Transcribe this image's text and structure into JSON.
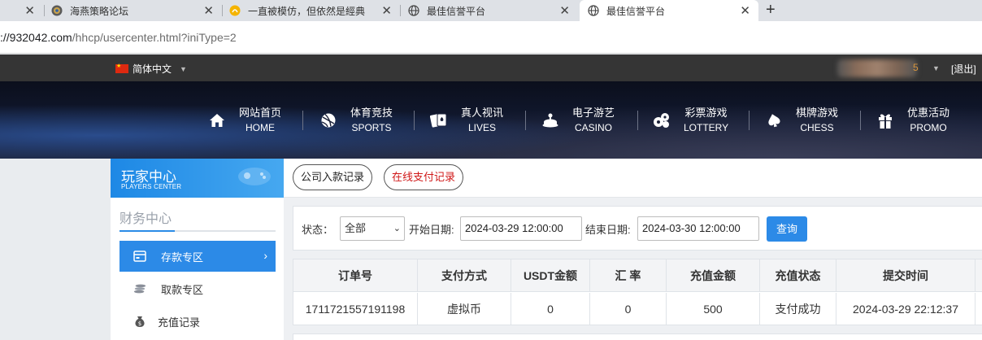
{
  "browser": {
    "tabs": [
      {
        "title": "",
        "icon": "close-icon"
      },
      {
        "title": "海燕策略论坛",
        "icon": "site-favicon"
      },
      {
        "title": "一直被模仿，但依然是經典",
        "icon": "site-favicon"
      },
      {
        "title": "最佳信誉平台",
        "icon": "globe-icon"
      },
      {
        "title": "最佳信誉平台",
        "icon": "globe-icon",
        "active": true
      }
    ],
    "new_tab_label": "+",
    "close_glyph": "✕",
    "address": {
      "host": "://932042.com",
      "path": "/hhcp/usercenter.html?iniType=2"
    }
  },
  "topbar": {
    "language": "简体中文",
    "user_suffix": "5",
    "logout": "[退出]"
  },
  "nav": {
    "items": [
      {
        "cn": "网站首页",
        "en": "HOME",
        "icon": "home-icon"
      },
      {
        "cn": "体育竞技",
        "en": "SPORTS",
        "icon": "basketball-icon"
      },
      {
        "cn": "真人视讯",
        "en": "LIVES",
        "icon": "cards-icon"
      },
      {
        "cn": "电子游艺",
        "en": "CASINO",
        "icon": "slot-machine-icon"
      },
      {
        "cn": "彩票游戏",
        "en": "LOTTERY",
        "icon": "lottery-balls-icon"
      },
      {
        "cn": "棋牌游戏",
        "en": "CHESS",
        "icon": "spade-icon"
      },
      {
        "cn": "优惠活动",
        "en": "PROMO",
        "icon": "gift-icon"
      }
    ]
  },
  "sidebar": {
    "header_cn": "玩家中心",
    "header_en": "PLAYERS CENTER",
    "section_title": "财务中心",
    "items": [
      {
        "label": "存款专区",
        "icon": "wallet-icon",
        "active": true
      },
      {
        "label": "取款专区",
        "icon": "coins-icon"
      },
      {
        "label": "充值记录",
        "icon": "money-bag-icon"
      }
    ],
    "active_arrow": "›"
  },
  "main": {
    "record_tabs": [
      {
        "label": "公司入款记录"
      },
      {
        "label": "在线支付记录",
        "active": true
      }
    ],
    "filter": {
      "status_label": "状态：",
      "status_value": "全部",
      "start_label": "开始日期:",
      "start_value": "2024-03-29 12:00:00",
      "end_label": "结束日期:",
      "end_value": "2024-03-30 12:00:00",
      "query_button": "查询"
    },
    "table": {
      "columns": [
        "订单号",
        "支付方式",
        "USDT金额",
        "汇 率",
        "充值金额",
        "充值状态",
        "提交时间"
      ],
      "rows": [
        [
          "1711721557191198",
          "虚拟币",
          "0",
          "0",
          "500",
          "支付成功",
          "2024-03-29 22:12:37"
        ]
      ]
    }
  },
  "colors": {
    "primary": "#2c8ae7",
    "topbar": "#353535",
    "promo_red": "#d01818"
  }
}
